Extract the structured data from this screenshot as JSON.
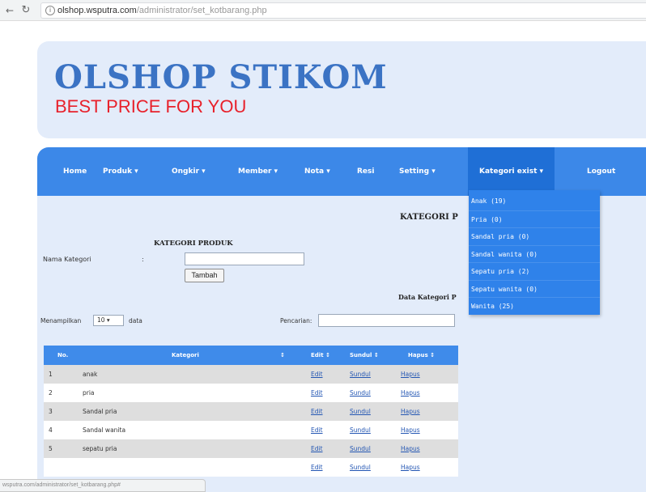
{
  "browser": {
    "url_domain": "olshop.wsputra.com",
    "url_path": "/administrator/set_kotbarang.php",
    "status_url": "wsputra.com/administrator/set_kotbarang.php#"
  },
  "header": {
    "logo": "OLSHOP STIKOM",
    "tagline": "BEST PRICE FOR YOU",
    "logo_color": "#3b73c4",
    "tagline_color": "#e8212b"
  },
  "navbar": {
    "items": [
      {
        "label": "Home"
      },
      {
        "label": "Produk ▾"
      },
      {
        "label": "Ongkir ▾"
      },
      {
        "label": "Member ▾"
      },
      {
        "label": "Nota ▾"
      },
      {
        "label": "Resi"
      },
      {
        "label": "Setting ▾"
      },
      {
        "label": "Kategori exist ▾"
      },
      {
        "label": "Logout"
      }
    ],
    "color": "#3c88e8"
  },
  "dropdown": {
    "items": [
      {
        "label": "Anak (19)"
      },
      {
        "label": "Pria (0)"
      },
      {
        "label": "Sandal pria (0)"
      },
      {
        "label": "Sandal wanita (0)"
      },
      {
        "label": "Sepatu pria (2)"
      },
      {
        "label": "Sepatu wanita (0)"
      },
      {
        "label": "Wanita (25)"
      }
    ]
  },
  "main": {
    "heading_right": "KATEGORI P",
    "heading_left": "KATEGORI PRODUK",
    "form": {
      "label": "Nama Kategori",
      "colon": ":",
      "input_value": "",
      "button_label": "Tambah"
    },
    "data_heading": "Data Kategori P",
    "show": {
      "before": "Menampilkan",
      "value": "10 ▾",
      "after": "data"
    },
    "search": {
      "label": "Pencarian:",
      "value": ""
    }
  },
  "table": {
    "headers": [
      "No.",
      "Kategori",
      "↕",
      "Edit ↕",
      "Sundul ↕",
      "Hapus ↕"
    ],
    "rows": [
      {
        "no": "1",
        "kategori": "anak",
        "edit": "Edit",
        "sundul": "Sundul",
        "hapus": "Hapus"
      },
      {
        "no": "2",
        "kategori": "pria",
        "edit": "Edit",
        "sundul": "Sundul",
        "hapus": "Hapus"
      },
      {
        "no": "3",
        "kategori": "Sandal pria",
        "edit": "Edit",
        "sundul": "Sundul",
        "hapus": "Hapus"
      },
      {
        "no": "4",
        "kategori": "Sandal wanita",
        "edit": "Edit",
        "sundul": "Sundul",
        "hapus": "Hapus"
      },
      {
        "no": "5",
        "kategori": "sepatu pria",
        "edit": "Edit",
        "sundul": "Sundul",
        "hapus": "Hapus"
      },
      {
        "no": "",
        "kategori": "",
        "edit": "Edit",
        "sundul": "Sundul",
        "hapus": "Hapus"
      }
    ]
  }
}
